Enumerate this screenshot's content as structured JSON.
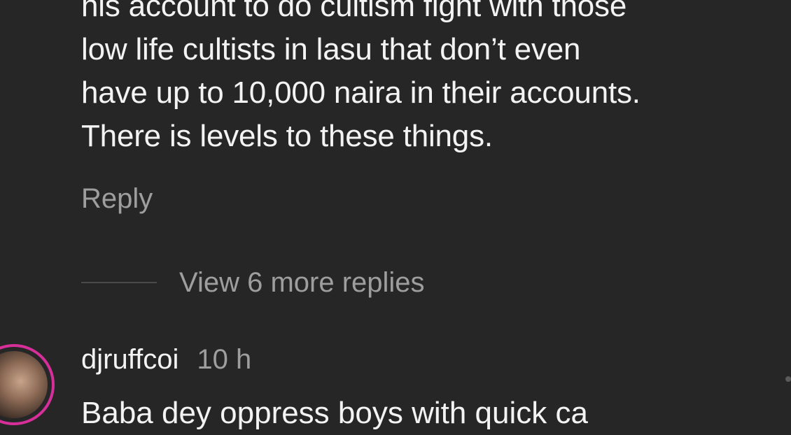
{
  "comment": {
    "lines": [
      "his account to do cultism fight with those",
      "low life cultists in lasu that don’t even",
      "have up to 10,000 naira in their accounts.",
      "There is levels to these things."
    ],
    "reply_label": "Reply"
  },
  "view_more_replies": {
    "label": "View 6 more replies"
  },
  "next_comment": {
    "username": "djruffcoi",
    "timestamp": "10 h",
    "text_partial": "Baba dey oppress boys with quick ca"
  },
  "colors": {
    "background": "#262626",
    "text_primary": "#f3f3f3",
    "text_secondary": "#9e9e9e",
    "story_ring": "#d72f9a"
  }
}
